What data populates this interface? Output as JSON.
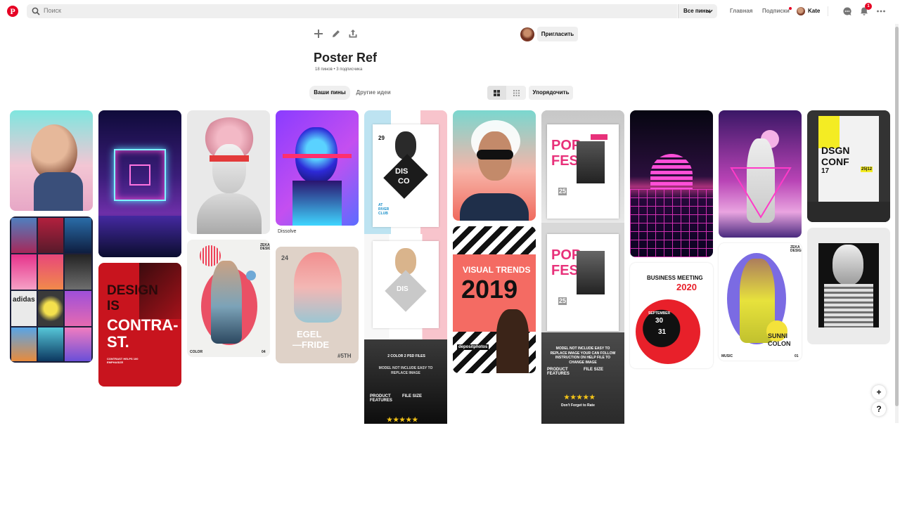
{
  "header": {
    "logo_letter": "P",
    "search_placeholder": "Поиск",
    "filter_label": "Все пины",
    "nav_home": "Главная",
    "nav_following": "Подписки",
    "user_name": "Kate",
    "notification_count": "1"
  },
  "board": {
    "invite_label": "Пригласить",
    "title": "Poster Ref",
    "meta": "18 пинов • 3 подписчика",
    "tab_your_pins": "Ваши пины",
    "tab_more_ideas": "Другие идеи",
    "sort_label": "Упорядочить"
  },
  "pins": {
    "p4_caption": "Dissolve",
    "p6_line1": "DESIGN",
    "p6_line2": "IS",
    "p6_line3": "CONTRA-",
    "p6_line4": "ST.",
    "p6_sub": "CONTRAST HELPS 100 EMPHASIZE",
    "p7_label": "COLOR",
    "p7_num": "04",
    "p7_brand": "ZEKA DESIGN",
    "p8_day": "24",
    "p8_title1": "EGEL",
    "p8_title2": "—FRIDE",
    "p8_tag": "#5TH",
    "p9_top": "29",
    "p9_title1": "DIS",
    "p9_title2": "CO",
    "p9_sub": "NIGHT PARTY",
    "p9_club": "AT RIVER CLUB",
    "p9_psd": "2 COLOR 2 PSD FILES",
    "p9_note": "MODEL NOT INCLUDE EASY TO REPLACE IMAGE",
    "p9_feat": "PRODUCT FEATURES",
    "p9_size": "FILE SIZE",
    "p11_line1": "VISUAL TRENDS",
    "p11_line2": "2019",
    "p11_brand": "depositphotos",
    "p12_title1": "POP",
    "p12_title2": "FEST",
    "p12_day": "25",
    "p12_note": "MODEL NOT INCLUDE EASY TO REPLACE IMAGE YOUR CAN FOLLOW INSTRUCTION ON HELP FILE TO CHANGE IMAGE",
    "p12_feat": "PRODUCT FEATURES",
    "p12_size": "FILE SIZE",
    "p12_rate": "Don't Forget to Rate",
    "p12_stars": "★★★★★",
    "p9_stars": "★★★★★",
    "p14_title": "BUSINESS MEETING",
    "p14_year": "2020",
    "p14_month": "SEPTEMBER",
    "p14_d1": "30",
    "p14_d2": "31",
    "p16_brand": "ZEKA DESIGN",
    "p16_title1": "SUNNI",
    "p16_title2": "COLON",
    "p16_music": "MUSIC",
    "p16_num": "01",
    "p17_title1": "DSGN",
    "p17_title2": "CONF",
    "p17_num": "17",
    "p17_date": "25|12",
    "p2_word": "adidas"
  },
  "floating": {
    "add": "+",
    "help": "?"
  }
}
